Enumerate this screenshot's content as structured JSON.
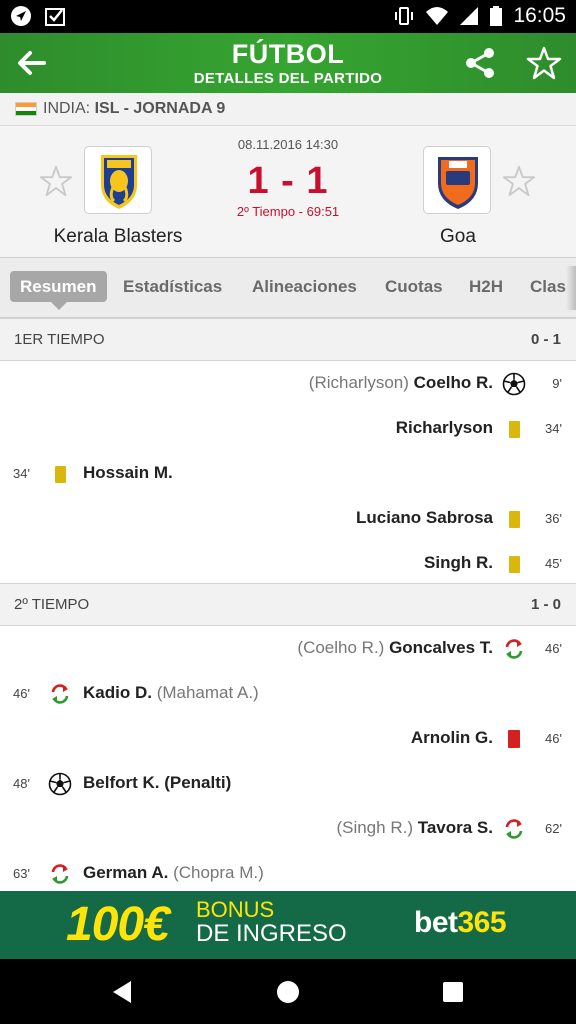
{
  "status_bar": {
    "time": "16:05"
  },
  "app_bar": {
    "title": "FÚTBOL",
    "subtitle": "DETALLES DEL PARTIDO"
  },
  "league": {
    "country": "INDIA:",
    "name": "ISL - JORNADA 9"
  },
  "match": {
    "date": "08.11.2016 14:30",
    "score": "1 - 1",
    "status": "2º Tiempo - 69:51",
    "home": {
      "name": "Kerala Blasters",
      "logo_text": "KERALA BLASTERS"
    },
    "away": {
      "name": "Goa",
      "logo_text": "FC GOA"
    }
  },
  "tabs": [
    "Resumen",
    "Estadísticas",
    "Alineaciones",
    "Cuotas",
    "H2H",
    "Clas"
  ],
  "periods": [
    {
      "name": "1ER TIEMPO",
      "score": "0 - 1",
      "events": [
        {
          "side": "away",
          "minute": "9'",
          "type": "goal-icon",
          "player": "Coelho R.",
          "detail": "(Richarlyson)"
        },
        {
          "side": "away",
          "minute": "34'",
          "type": "yellow-card-icon",
          "player": "Richarlyson",
          "detail": ""
        },
        {
          "side": "home",
          "minute": "34'",
          "type": "yellow-card-icon",
          "player": "Hossain M.",
          "detail": ""
        },
        {
          "side": "away",
          "minute": "36'",
          "type": "yellow-card-icon",
          "player": "Luciano Sabrosa",
          "detail": ""
        },
        {
          "side": "away",
          "minute": "45'",
          "type": "yellow-card-icon",
          "player": "Singh R.",
          "detail": ""
        }
      ]
    },
    {
      "name": "2º TIEMPO",
      "score": "1 - 0",
      "events": [
        {
          "side": "away",
          "minute": "46'",
          "type": "substitution-icon",
          "player": "Goncalves T.",
          "detail": "(Coelho R.)"
        },
        {
          "side": "home",
          "minute": "46'",
          "type": "substitution-icon",
          "player": "Kadio D.",
          "detail": "(Mahamat A.)"
        },
        {
          "side": "away",
          "minute": "46'",
          "type": "red-card-icon",
          "player": "Arnolin G.",
          "detail": ""
        },
        {
          "side": "home",
          "minute": "48'",
          "type": "goal-icon",
          "player": "Belfort K. (Penalti)",
          "detail": ""
        },
        {
          "side": "away",
          "minute": "62'",
          "type": "substitution-icon",
          "player": "Tavora S.",
          "detail": "(Singh R.)"
        },
        {
          "side": "home",
          "minute": "63'",
          "type": "substitution-icon",
          "player": "German A.",
          "detail": "(Chopra M.)"
        }
      ]
    }
  ],
  "ad": {
    "amount": "100€",
    "line1": "BONUS",
    "line2": "DE INGRESO",
    "brand_a": "bet",
    "brand_b": "365"
  },
  "colors": {
    "app_green": "#36a531",
    "score_red": "#c8102e",
    "yellow_card": "#d9b70c",
    "red_card": "#d42020",
    "ad_green": "#146a46",
    "ad_yellow": "#ffe40a"
  }
}
